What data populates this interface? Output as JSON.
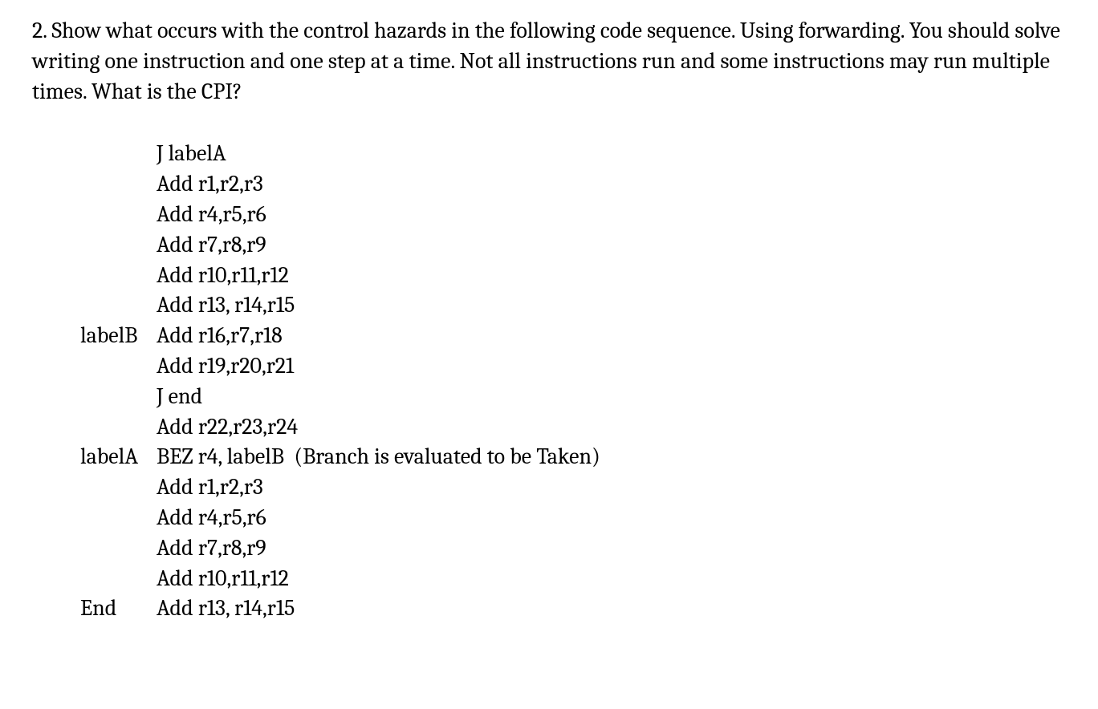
{
  "question": {
    "number": "2.",
    "text": "Show what occurs with the control hazards in the following code sequence. Using forwarding.  You should solve writing one instruction and one step at a time. Not all instructions run and some instructions may run multiple times.  What is the CPI?"
  },
  "code": {
    "lines": [
      {
        "label": "",
        "instruction": "J labelA"
      },
      {
        "label": "",
        "instruction": "Add r1,r2,r3"
      },
      {
        "label": "",
        "instruction": "Add r4,r5,r6"
      },
      {
        "label": "",
        "instruction": "Add r7,r8,r9"
      },
      {
        "label": "",
        "instruction": "Add r10,r11,r12"
      },
      {
        "label": "",
        "instruction": "Add r13, r14,r15"
      },
      {
        "label": "labelB",
        "instruction": "Add r16,r7,r18"
      },
      {
        "label": "",
        "instruction": "Add r19,r20,r21"
      },
      {
        "label": "",
        "instruction": "J end"
      },
      {
        "label": "",
        "instruction": "Add r22,r23,r24"
      },
      {
        "label": "labelA",
        "instruction": "BEZ r4, labelB  (Branch is evaluated to be Taken)"
      },
      {
        "label": "",
        "instruction": "Add r1,r2,r3"
      },
      {
        "label": "",
        "instruction": "Add r4,r5,r6"
      },
      {
        "label": "",
        "instruction": "Add r7,r8,r9"
      },
      {
        "label": "",
        "instruction": "Add r10,r11,r12"
      },
      {
        "label": "End",
        "instruction": "Add r13, r14,r15"
      }
    ]
  }
}
